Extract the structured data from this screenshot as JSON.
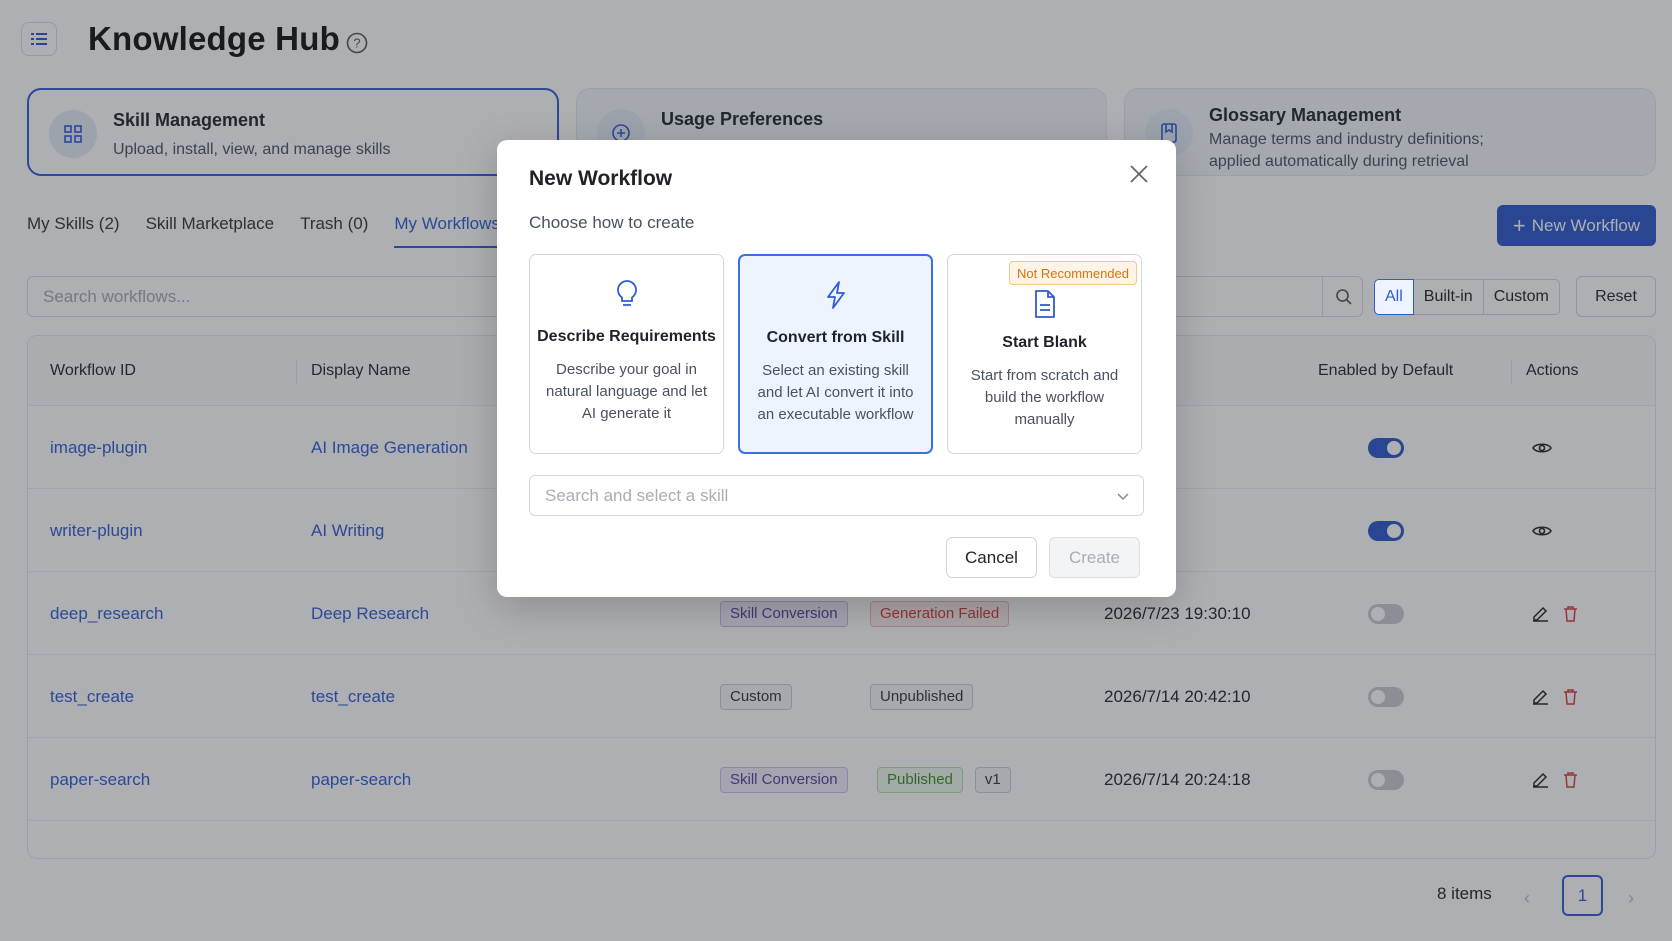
{
  "page": {
    "title": "Knowledge Hub"
  },
  "cards": [
    {
      "title": "Skill Management",
      "description": "Upload, install, view, and manage skills",
      "icon": "grid-icon"
    },
    {
      "title": "Usage Preferences",
      "description": "",
      "icon": "preferences-icon"
    },
    {
      "title": "Glossary Management",
      "description_line1": "Manage terms and industry definitions;",
      "description_line2": "applied automatically during retrieval",
      "icon": "glossary-icon"
    }
  ],
  "tabs": [
    {
      "label": "My Skills (2)"
    },
    {
      "label": "Skill Marketplace"
    },
    {
      "label": "Trash (0)"
    },
    {
      "label": "My Workflows",
      "active": true
    }
  ],
  "toolbar": {
    "new_workflow_label": "New Workflow",
    "search_placeholder": "Search workflows...",
    "filters": [
      "All",
      "Built-in",
      "Custom"
    ],
    "selected_filter": "All",
    "reset_label": "Reset"
  },
  "table": {
    "columns": {
      "workflow_id": "Workflow ID",
      "display_name": "Display Name",
      "enabled": "Enabled by Default",
      "actions": "Actions"
    },
    "rows": [
      {
        "id": "image-plugin",
        "name": "AI Image Generation",
        "type": "",
        "status": "",
        "version": "",
        "updated": "",
        "enabled": true,
        "actions": [
          "view"
        ]
      },
      {
        "id": "writer-plugin",
        "name": "AI Writing",
        "type": "",
        "status": "",
        "version": "",
        "updated": "",
        "enabled": true,
        "actions": [
          "view"
        ]
      },
      {
        "id": "deep_research",
        "name": "Deep Research",
        "type": "Skill Conversion",
        "status": "Generation Failed",
        "version": "",
        "updated": "2026/7/23 19:30:10",
        "enabled": false,
        "actions": [
          "edit",
          "delete"
        ]
      },
      {
        "id": "test_create",
        "name": "test_create",
        "type": "Custom",
        "status": "Unpublished",
        "version": "",
        "updated": "2026/7/14 20:42:10",
        "enabled": false,
        "actions": [
          "edit",
          "delete"
        ]
      },
      {
        "id": "paper-search",
        "name": "paper-search",
        "type": "Skill Conversion",
        "status": "Published",
        "version": "v1",
        "updated": "2026/7/14 20:24:18",
        "enabled": false,
        "actions": [
          "edit",
          "delete"
        ]
      }
    ]
  },
  "pagination": {
    "total_label": "8 items",
    "current_page": "1",
    "prev": "‹",
    "next": "›"
  },
  "modal": {
    "title": "New Workflow",
    "subtitle": "Choose how to create",
    "options": [
      {
        "title": "Describe Requirements",
        "description": "Describe your goal in natural language and let AI generate it",
        "icon": "lightbulb-icon",
        "selected": false
      },
      {
        "title": "Convert from Skill",
        "description": "Select an existing skill and let AI convert it into an executable workflow",
        "icon": "lightning-icon",
        "selected": true
      },
      {
        "title": "Start Blank",
        "description": "Start from scratch and build the workflow manually",
        "icon": "document-icon",
        "selected": false,
        "badge": "Not Recommended"
      }
    ],
    "skill_select_placeholder": "Search and select a skill",
    "cancel_label": "Cancel",
    "create_label": "Create"
  },
  "colors": {
    "accent": "#2d55cc",
    "overlay": "rgba(40,44,52,0.38)"
  }
}
